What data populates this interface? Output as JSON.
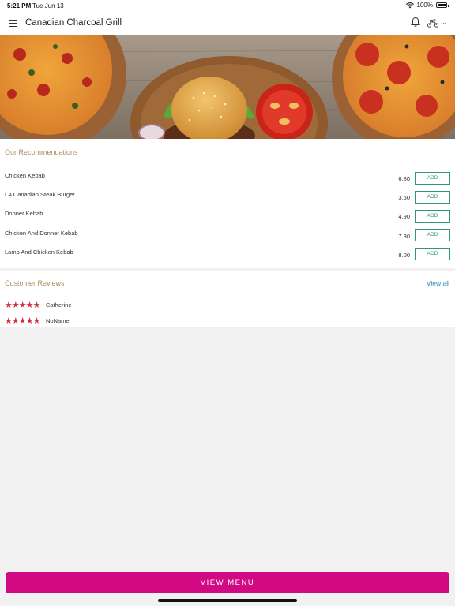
{
  "status_bar": {
    "time": "5:21 PM",
    "date": "Tue Jun 13",
    "battery": "100%",
    "icons": [
      "wifi-icon",
      "battery-icon"
    ]
  },
  "header": {
    "title": "Canadian Charcoal Grill",
    "icons": [
      "menu-icon",
      "bell-icon",
      "scooter-icon",
      "chevron-down-icon"
    ]
  },
  "recommendations": {
    "title": "Our Recommendations",
    "add_label": "ADD",
    "items": [
      {
        "name": "Chicken Kebab",
        "price": "6.80"
      },
      {
        "name": "LA Canadian Steak Burger",
        "price": "3.50"
      },
      {
        "name": "Donner Kebab",
        "price": "4.90"
      },
      {
        "name": "Chicken And Donner Kebab",
        "price": "7.30"
      },
      {
        "name": "Lamb And Chicken Kebab",
        "price": "8.00"
      }
    ]
  },
  "reviews": {
    "title": "Customer Reviews",
    "view_all": "View all",
    "items": [
      {
        "name": "Catherine",
        "stars": "★★★★★",
        "rating": 5
      },
      {
        "name": "NoName",
        "stars": "★★★★★",
        "rating": 5
      }
    ]
  },
  "footer": {
    "view_menu": "VIEW MENU"
  },
  "colors": {
    "accent": "#d10a84",
    "add_green": "#2f9a6d",
    "section_title": "#a98f5e",
    "link_blue": "#2a87ba",
    "star_red": "#d0313f"
  }
}
